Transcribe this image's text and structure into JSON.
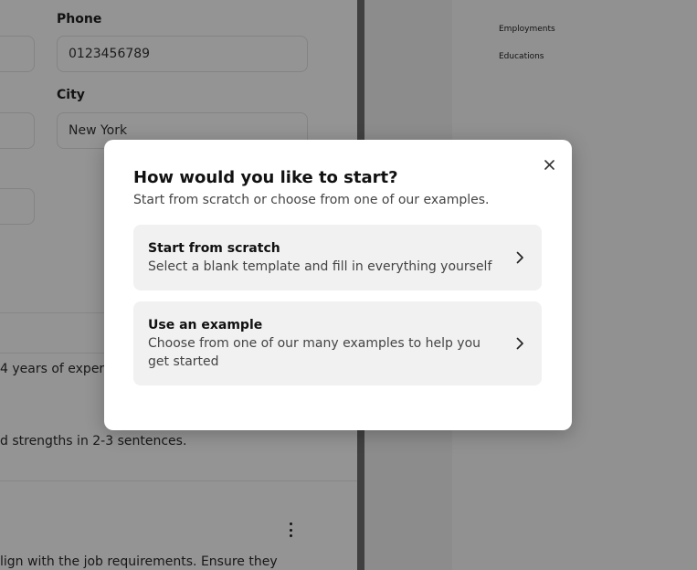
{
  "form": {
    "phone_label": "Phone",
    "phone_value": "0123456789",
    "city_label": "City",
    "city_value": "New York",
    "summary_fragment": "4 years of exper",
    "summary_hint": "d strengths in 2-3 sentences.",
    "skills_hint": "lign with the job requirements. Ensure they"
  },
  "preview": {
    "sections": [
      "Employments",
      "Educations"
    ]
  },
  "modal": {
    "title": "How would you like to start?",
    "subtitle": "Start from scratch or choose from one of our examples.",
    "options": [
      {
        "title": "Start from scratch",
        "description": "Select a blank template and fill in everything yourself"
      },
      {
        "title": "Use an example",
        "description": "Choose from one of our many examples to help you get started"
      }
    ]
  },
  "icons": {
    "close": "close-icon",
    "chevron": "chevron-right-icon",
    "menu": "kebab-menu-icon"
  },
  "colors": {
    "overlay": "#6b6b6b",
    "modal_bg": "#ffffff",
    "option_bg": "#f1f1f1",
    "divider": "#6f6f6f"
  }
}
